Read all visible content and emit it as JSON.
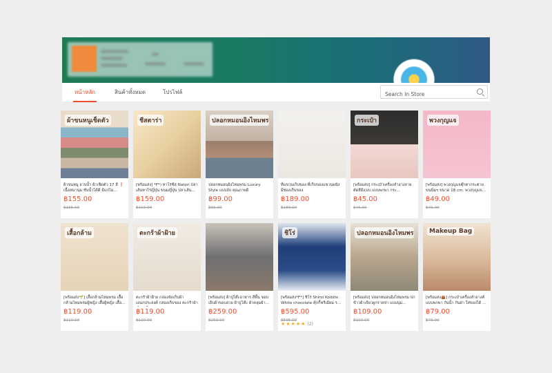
{
  "tabs": [
    {
      "label": "หน้าหลัก",
      "active": true
    },
    {
      "label": "สินค้าทั้งหมด",
      "active": false
    },
    {
      "label": "โปรไฟล์",
      "active": false
    }
  ],
  "search": {
    "placeholder": "Search In Store",
    "icon": "search-icon"
  },
  "colors": {
    "accent": "#ee4d2d",
    "old_price": "#999999",
    "star": "#f5a623"
  },
  "products": [
    {
      "thumb_text": "ผ้าขนหนูเช็ดตัว",
      "title": "ผ้าขนหนู อาบน้ำ ผ้าเช็ดตัว 17 สี ❗ เนื้อหนานุ่ม ซับน้ำได้ดี มีแก่ไม...",
      "price": "฿155.00",
      "old_price": "฿155.00"
    },
    {
      "thumb_text": "ชีสตาร่า",
      "title": "[พร้อมส่ง] *F*) ทาโร่ซีส Natori ปลาเส้นทาโร่ญี่ปุ่น ขนมญี่ปุ่น ปลาเส้น...",
      "price": "฿159.00",
      "old_price": "฿159.00"
    },
    {
      "thumb_text": "ปลอกหมอนอิงไหมพรม",
      "title": "ปลอกหมอนอิงไหมพรม Luxury Style แบบถัก คุณภาพดี ขนาด45x45ซ...",
      "price": "฿99.00",
      "old_price": "฿99.00"
    },
    {
      "thumb_text": "",
      "title": "ที่แขวนเก็บของ ที่เก็บของแขวนผนัง มีช่องเก็บของ",
      "price": "฿189.00",
      "old_price": "฿189.00"
    },
    {
      "thumb_text": "กระเป๋า",
      "title": "[พร้อมส่ง] กระเป๋าเครื่องสำอางลายตัดสีมีแบบ แบบพกพา กระ...",
      "price": "฿45.00",
      "old_price": "฿45.00"
    },
    {
      "thumb_text": "พวงกุญแจ",
      "title": "[พร้อมส่ง] พวงกุญแจตุ๊กตากระต่ายขนนิ่มๆ ขนาด 18 cm. พวงกุญแจ...",
      "price": "฿49.00",
      "old_price": "฿49.00"
    },
    {
      "thumb_text": "เสื้อกล้าม",
      "title": "[พร้อมส่ง🌱] เสื้อกล้ามไหมพรม เสื้อกล้ามไหมพรมผู้หญิง เสื้อผู้หญิง เสื้อ...",
      "price": "฿119.00",
      "old_price": "฿119.00"
    },
    {
      "thumb_text": "ตะกร้าผ้าฝ้าย",
      "title": "ตะกร้าผ้าฝ้าย กล่องจัดเก็บผ้าเอนกประสงค์ กล่องเก็บของ ตะกร้าผ้า เก็บเครื่...",
      "price": "฿119.00",
      "old_price": "฿119.00"
    },
    {
      "thumb_text": "",
      "title": "[พร้อมส่ง] ผ้าปูโต๊ะอาหาร สีพื้น ขอบเย็บผ้าขอบสวย ผ้าปูโต๊ะ ผ้าคลุมผ้า...",
      "price": "฿259.00",
      "old_price": "฿259.00"
    },
    {
      "thumb_text": "ชิโร่",
      "title": "[พร้อมส่ง*F*] ชิโร่ Shiroi Koibito White chocolate คุ้กกี้ฟรีเมียม ร...",
      "price": "฿595.00",
      "old_price": "฿595.00",
      "rating_count": "(2)"
    },
    {
      "thumb_text": "ปลอกหมอนอิงไหมพรม",
      "title": "[พร้อมส่ง] ปลอกหมอนอิงไหมพรม ปกข้าวผ้าเจียวผูกรายข่า แบบนุ่ม...",
      "price": "฿109.00",
      "old_price": "฿109.00"
    },
    {
      "thumb_text": "Makeup Bag",
      "title": "[พร้อมส่ง👜] กระเป๋าเครื่องสำอางค์ แบบพกพา กันน้ำ กันฝ่า ใส่ของได้ ...",
      "price": "฿79.00",
      "old_price": "฿79.00"
    }
  ]
}
